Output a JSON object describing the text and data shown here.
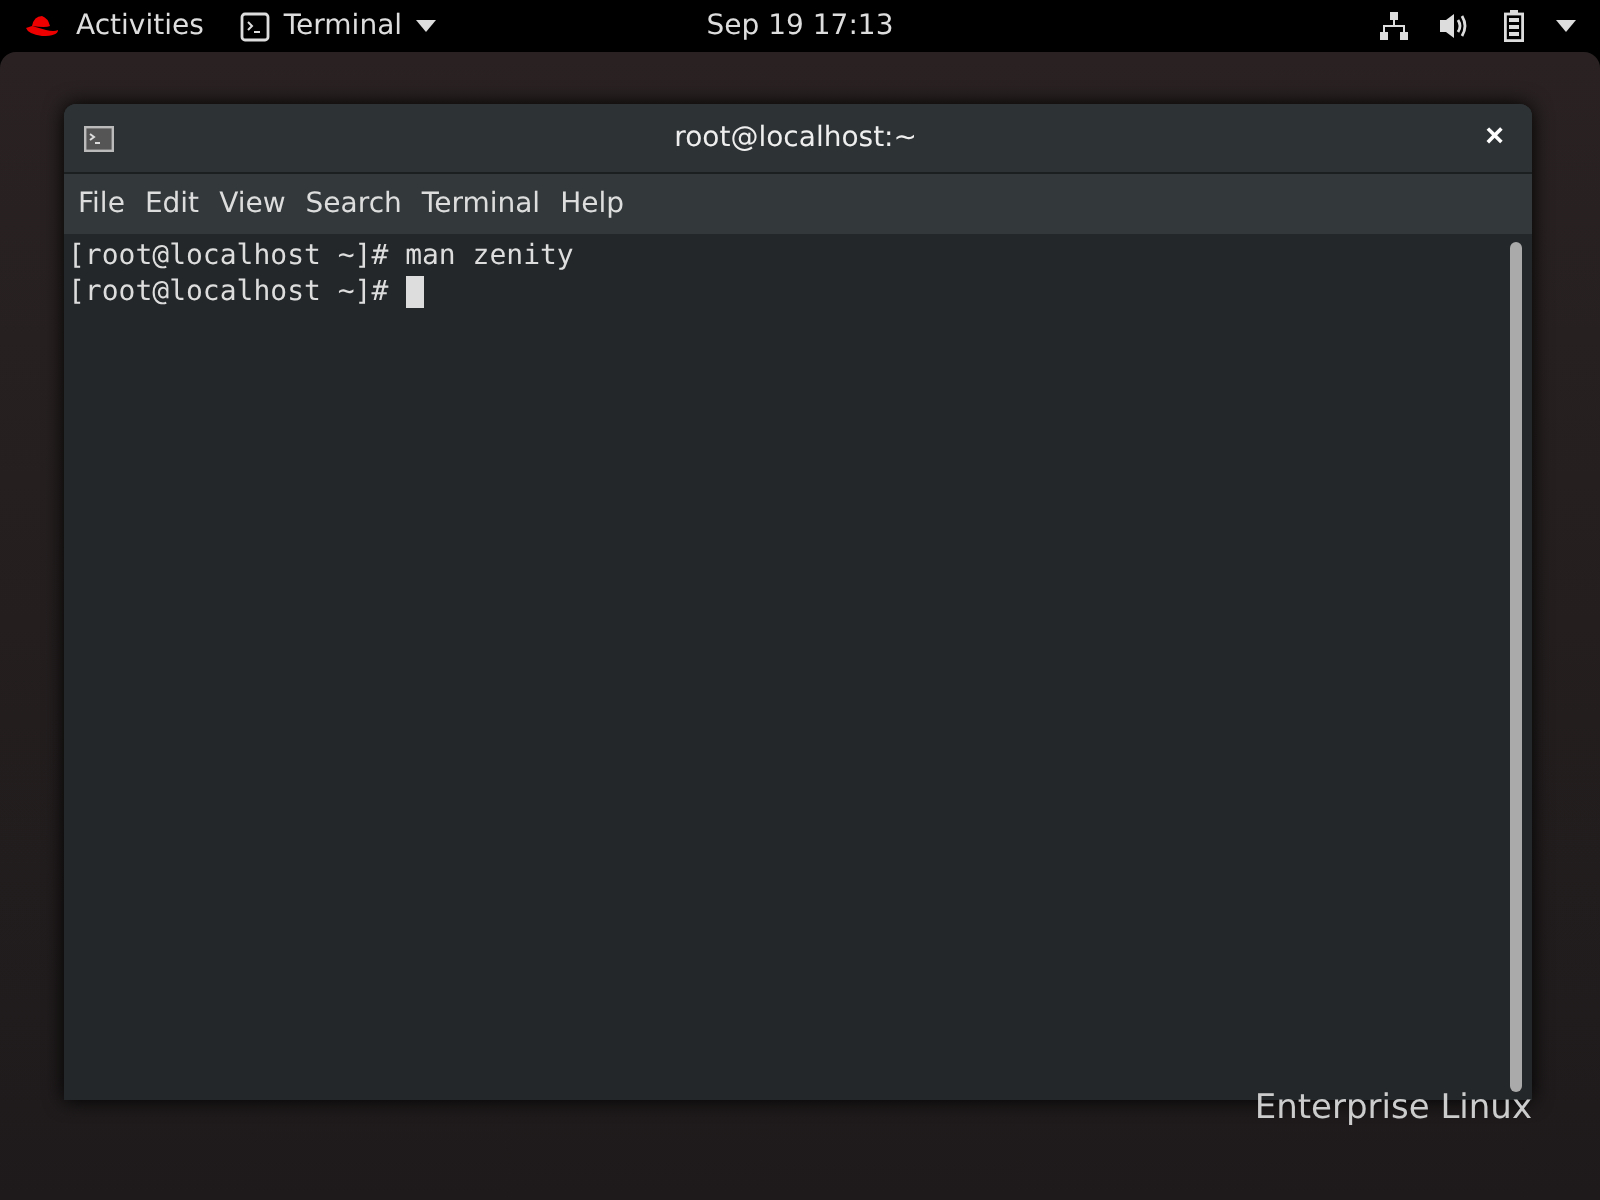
{
  "top_bar": {
    "activities": "Activities",
    "app_menu": "Terminal",
    "clock": "Sep 19  17:13"
  },
  "window": {
    "title": "root@localhost:~",
    "close": "×"
  },
  "menu": [
    "File",
    "Edit",
    "View",
    "Search",
    "Terminal",
    "Help"
  ],
  "terminal": {
    "lines": [
      "[root@localhost ~]# man zenity",
      "[root@localhost ~]# "
    ]
  },
  "desktop": {
    "brand": "Enterprise Linux"
  }
}
